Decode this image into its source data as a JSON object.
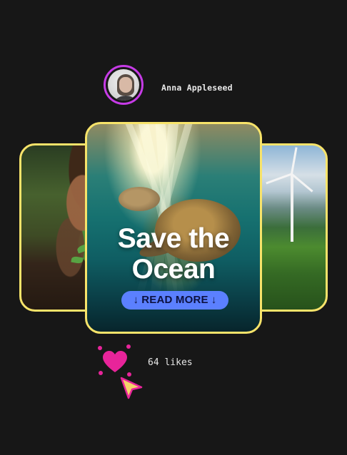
{
  "profile": {
    "name": "Anna Appleseed",
    "avatar_icon": "person-portrait",
    "ring_color": "#c63be6"
  },
  "cards": {
    "border_color": "#f7e36a",
    "left": {
      "image": "child-planting-seedling"
    },
    "right": {
      "image": "wind-turbine-hills"
    },
    "main": {
      "image": "sea-turtle-underwater",
      "title": "Save the\nOcean",
      "button_label": "READ MORE",
      "button_icon": "arrow-down-icon",
      "button_color": "#5b80ff"
    }
  },
  "likes": {
    "text": "64 likes",
    "heart_color": "#e8249a",
    "cursor_color": "#f3d46a"
  }
}
